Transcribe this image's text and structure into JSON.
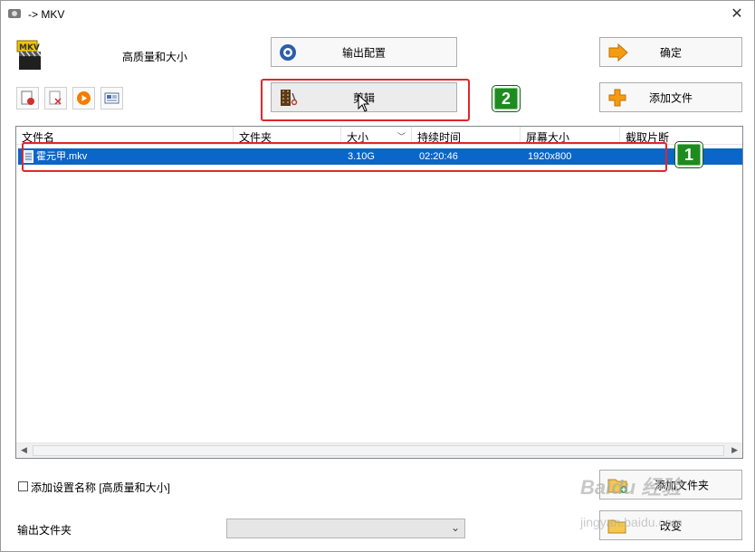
{
  "window": {
    "title": "-> MKV",
    "close_glyph": "✕"
  },
  "preset": {
    "icon_text": "MKV",
    "label": "高质量和大小"
  },
  "buttons": {
    "output_config": "输出配置",
    "ok": "确定",
    "clip": "剪辑",
    "add_file": "添加文件",
    "add_folder": "添加文件夹",
    "change": "改变"
  },
  "toolbar": [
    "remove-icon",
    "clear-icon",
    "play-icon",
    "info-icon"
  ],
  "list": {
    "columns": [
      "文件名",
      "文件夹",
      "大小",
      "持续时间",
      "屏幕大小",
      "截取片断"
    ],
    "rows": [
      {
        "name": "霍元甲.mkv",
        "folder": "",
        "size": "3.10G",
        "duration": "02:20:46",
        "screen": "1920x800",
        "clip": ""
      }
    ]
  },
  "options": {
    "add_setting_name": "添加设置名称 [高质量和大小]",
    "output_folder_label": "输出文件夹",
    "output_folder_value": ""
  },
  "annotations": {
    "badge1": "1",
    "badge2": "2",
    "highlight_color": "#e0262c",
    "badge_color": "#1e8b1e"
  },
  "watermark": {
    "main": "Baidu 经验",
    "sub": "jingyan.baidu.com"
  }
}
